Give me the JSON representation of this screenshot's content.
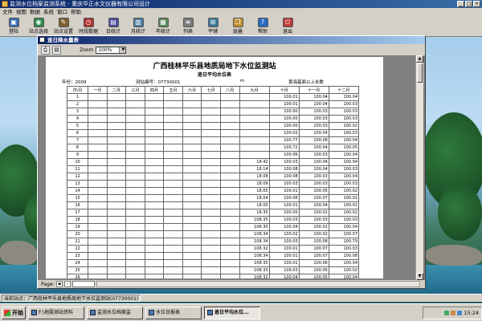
{
  "app": {
    "title": "监测水位档案监测系统 - 重庆华正水文仪器有限公司设计",
    "menus": [
      "文件",
      "视图",
      "数据",
      "系统",
      "窗口",
      "帮助"
    ],
    "toolbar": [
      {
        "label": "登陆",
        "icon": "login-icon"
      },
      {
        "label": "站点选择",
        "icon": "site-icon"
      },
      {
        "label": "站点设置",
        "icon": "settings-icon"
      },
      {
        "label": "时段数据",
        "icon": "timedata-icon"
      },
      {
        "label": "日统计",
        "icon": "day-stats-icon"
      },
      {
        "label": "月统计",
        "icon": "month-stats-icon"
      },
      {
        "label": "年统计",
        "icon": "year-stats-icon"
      },
      {
        "label": "列表",
        "icon": "list-icon"
      },
      {
        "label": "平铺",
        "icon": "tile-icon"
      },
      {
        "label": "层叠",
        "icon": "cascade-icon"
      },
      {
        "label": "帮助",
        "icon": "help-icon"
      },
      {
        "label": "退出",
        "icon": "exit-icon"
      }
    ]
  },
  "report_window": {
    "title": "逐日降水量表",
    "zoom_label": "Zoom",
    "zoom_value": "100%",
    "page_label": "Page:"
  },
  "report": {
    "title": "广西桂林平乐县地质局地下水位监测站",
    "subtitle": "逐日平均水位表",
    "year_label": "年份：2009",
    "station_label": "测站编号：07730001",
    "unit_label": "m",
    "datum_label": "黄海基面以上米数",
    "columns": [
      "日\\月",
      "一月",
      "二月",
      "三月",
      "四月",
      "五月",
      "六月",
      "七月",
      "八月",
      "九月",
      "十月",
      "十一月",
      "十二月"
    ],
    "rows": [
      [
        "1",
        "",
        "",
        "",
        "",
        "",
        "",
        "",
        "",
        "",
        "100.01",
        "100.04",
        "100.04"
      ],
      [
        "2",
        "",
        "",
        "",
        "",
        "",
        "",
        "",
        "",
        "",
        "100.01",
        "100.04",
        "100.03"
      ],
      [
        "3",
        "",
        "",
        "",
        "",
        "",
        "",
        "",
        "",
        "",
        "100.00",
        "100.03",
        "100.03"
      ],
      [
        "4",
        "",
        "",
        "",
        "",
        "",
        "",
        "",
        "",
        "",
        "100.00",
        "100.03",
        "100.03"
      ],
      [
        "5",
        "",
        "",
        "",
        "",
        "",
        "",
        "",
        "",
        "",
        "100.00",
        "100.03",
        "100.02"
      ],
      [
        "6",
        "",
        "",
        "",
        "",
        "",
        "",
        "",
        "",
        "",
        "100.02",
        "100.04",
        "100.03"
      ],
      [
        "7",
        "",
        "",
        "",
        "",
        "",
        "",
        "",
        "",
        "",
        "100.77",
        "100.08",
        "100.04"
      ],
      [
        "8",
        "",
        "",
        "",
        "",
        "",
        "",
        "",
        "",
        "",
        "100.72",
        "100.04",
        "100.05"
      ],
      [
        "9",
        "",
        "",
        "",
        "",
        "",
        "",
        "",
        "",
        "",
        "100.06",
        "100.03",
        "100.04"
      ],
      [
        "10",
        "",
        "",
        "",
        "",
        "",
        "",
        "",
        "",
        "18.42",
        "100.03",
        "100.04",
        "100.04"
      ],
      [
        "11",
        "",
        "",
        "",
        "",
        "",
        "",
        "",
        "",
        "18.14",
        "100.08",
        "100.04",
        "100.03"
      ],
      [
        "12",
        "",
        "",
        "",
        "",
        "",
        "",
        "",
        "",
        "18.08",
        "100.08",
        "100.03",
        "100.04"
      ],
      [
        "13",
        "",
        "",
        "",
        "",
        "",
        "",
        "",
        "",
        "18.09",
        "100.03",
        "100.03",
        "100.03"
      ],
      [
        "14",
        "",
        "",
        "",
        "",
        "",
        "",
        "",
        "",
        "18.05",
        "100.01",
        "100.05",
        "100.02"
      ],
      [
        "15",
        "",
        "",
        "",
        "",
        "",
        "",
        "",
        "",
        "18.04",
        "100.06",
        "100.07",
        "100.01"
      ],
      [
        "16",
        "",
        "",
        "",
        "",
        "",
        "",
        "",
        "",
        "18.00",
        "100.01",
        "100.04",
        "100.01"
      ],
      [
        "17",
        "",
        "",
        "",
        "",
        "",
        "",
        "",
        "",
        "18.35",
        "100.00",
        "100.02",
        "100.02"
      ],
      [
        "18",
        "",
        "",
        "",
        "",
        "",
        "",
        "",
        "",
        "108.35",
        "100.03",
        "100.03",
        "100.03"
      ],
      [
        "19",
        "",
        "",
        "",
        "",
        "",
        "",
        "",
        "",
        "108.30",
        "100.04",
        "100.02",
        "100.04"
      ],
      [
        "20",
        "",
        "",
        "",
        "",
        "",
        "",
        "",
        "",
        "108.34",
        "100.02",
        "100.02",
        "100.07"
      ],
      [
        "21",
        "",
        "",
        "",
        "",
        "",
        "",
        "",
        "",
        "108.34",
        "100.03",
        "100.08",
        "100.79"
      ],
      [
        "22",
        "",
        "",
        "",
        "",
        "",
        "",
        "",
        "",
        "108.32",
        "100.01",
        "100.07",
        "100.03"
      ],
      [
        "23",
        "",
        "",
        "",
        "",
        "",
        "",
        "",
        "",
        "108.34",
        "100.01",
        "100.07",
        "100.08"
      ],
      [
        "24",
        "",
        "",
        "",
        "",
        "",
        "",
        "",
        "",
        "108.35",
        "100.01",
        "100.06",
        "100.04"
      ],
      [
        "25",
        "",
        "",
        "",
        "",
        "",
        "",
        "",
        "",
        "108.33",
        "100.03",
        "100.05",
        "100.02"
      ],
      [
        "26",
        "",
        "",
        "",
        "",
        "",
        "",
        "",
        "",
        "108.32",
        "100.04",
        "100.05",
        "100.04"
      ]
    ]
  },
  "status": {
    "text": "当前站点：广西桂林平乐县地质局地下水位监测站(07730001)"
  },
  "taskbar": {
    "start_label": "开始",
    "tasks": [
      {
        "label": "F:\\地震测站资料",
        "active": false
      },
      {
        "label": "监测水位档案监",
        "active": false
      },
      {
        "label": "水位日报表",
        "active": false
      },
      {
        "label": "逐日平均水位...",
        "active": true
      }
    ],
    "clock": "15:24"
  }
}
